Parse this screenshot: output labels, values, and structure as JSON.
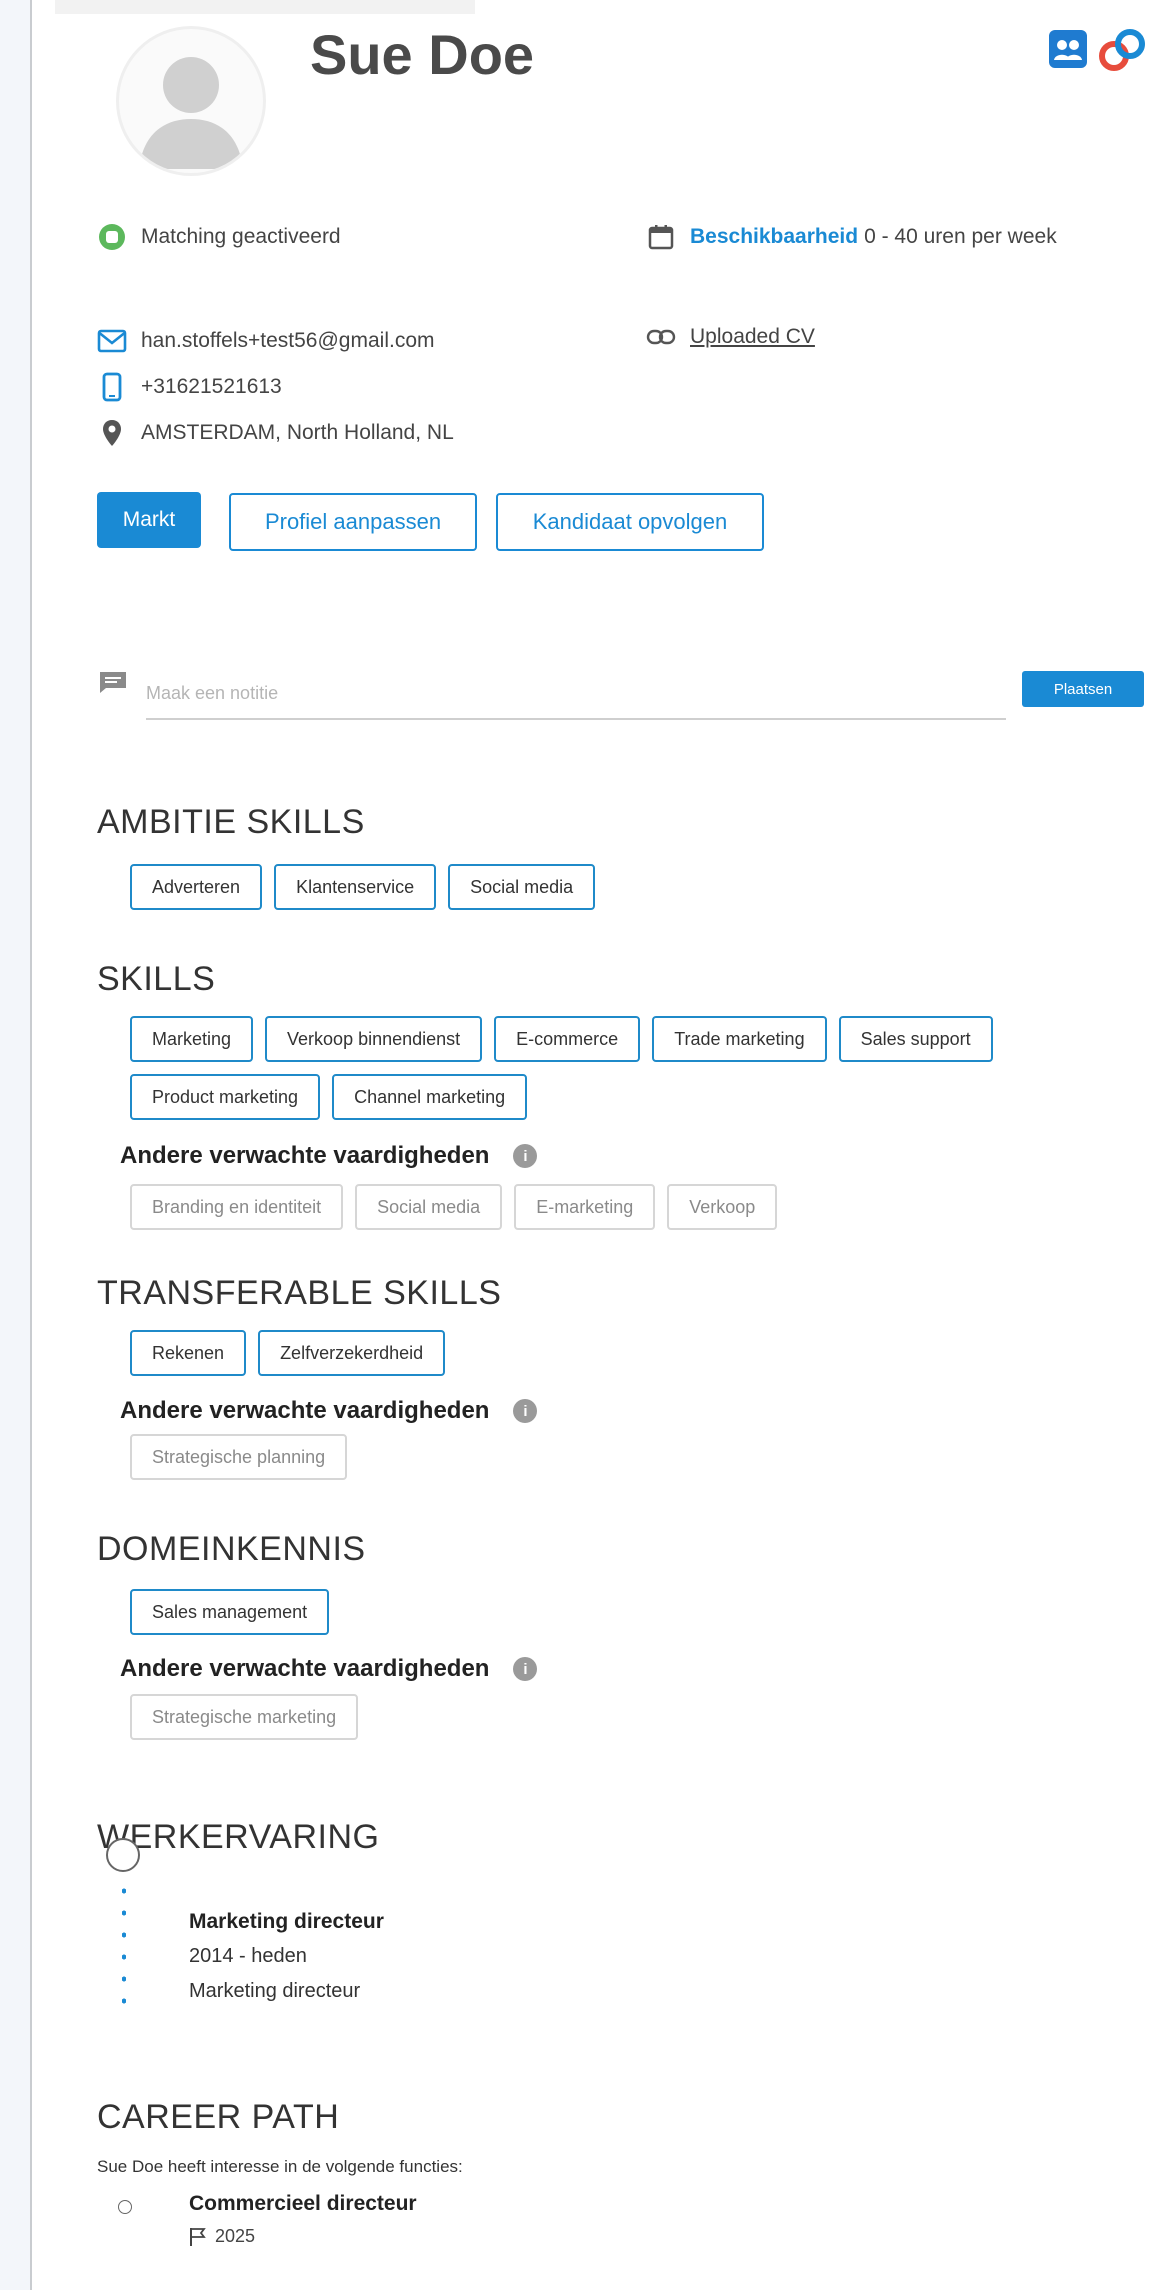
{
  "profile": {
    "name": "Sue Doe",
    "matching_status": "Matching geactiveerd",
    "availability_label": "Beschikbaarheid",
    "availability_value": "0 - 40 uren per week",
    "email": "han.stoffels+test56@gmail.com",
    "phone": "+31621521613",
    "location": "AMSTERDAM, North Holland, NL",
    "cv_link": "Uploaded CV"
  },
  "actions": {
    "markt": "Markt",
    "edit_profile": "Profiel aanpassen",
    "follow_candidate": "Kandidaat opvolgen"
  },
  "note": {
    "placeholder": "Maak een notitie",
    "submit": "Plaatsen"
  },
  "sections": {
    "ambition": {
      "title": "AMBITIE SKILLS",
      "chips": [
        "Adverteren",
        "Klantenservice",
        "Social media"
      ]
    },
    "skills": {
      "title": "SKILLS",
      "chips": [
        "Marketing",
        "Verkoop binnendienst",
        "E-commerce",
        "Trade marketing",
        "Sales support",
        "Product marketing",
        "Channel marketing"
      ],
      "expected_title": "Andere verwachte vaardigheden",
      "expected": [
        "Branding en identiteit",
        "Social media",
        "E-marketing",
        "Verkoop"
      ]
    },
    "transferable": {
      "title": "TRANSFERABLE SKILLS",
      "chips": [
        "Rekenen",
        "Zelfverzekerdheid"
      ],
      "expected_title": "Andere verwachte vaardigheden",
      "expected": [
        "Strategische planning"
      ]
    },
    "domain": {
      "title": "DOMEINKENNIS",
      "chips": [
        "Sales management"
      ],
      "expected_title": "Andere verwachte vaardigheden",
      "expected": [
        "Strategische marketing"
      ]
    },
    "experience": {
      "title": "WERKERVARING",
      "items": [
        {
          "role": "Marketing directeur",
          "period": "2014 - heden",
          "description": "Marketing directeur"
        }
      ]
    },
    "career_path": {
      "title": "CAREER PATH",
      "intro": "Sue Doe heeft interesse in de volgende functies:",
      "items": [
        {
          "role": "Commercieel directeur",
          "year": "2025"
        }
      ]
    }
  },
  "colors": {
    "accent": "#1a8ad4",
    "success": "#5cb85c"
  }
}
